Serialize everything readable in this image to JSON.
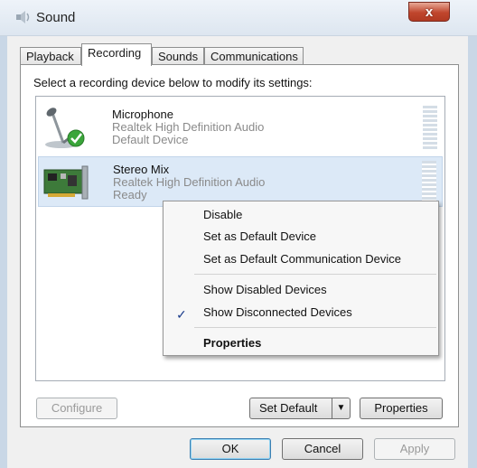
{
  "window": {
    "title": "Sound",
    "close_label": "x"
  },
  "tabs": [
    {
      "label": "Playback"
    },
    {
      "label": "Recording"
    },
    {
      "label": "Sounds"
    },
    {
      "label": "Communications"
    }
  ],
  "recording": {
    "instruction": "Select a recording device below to modify its settings:",
    "devices": [
      {
        "name": "Microphone",
        "description": "Realtek High Definition Audio",
        "status": "Default Device",
        "icon": "microphone-icon",
        "default_check": true
      },
      {
        "name": "Stereo Mix",
        "description": "Realtek High Definition Audio",
        "status": "Ready",
        "icon": "sound-card-icon",
        "selected": true
      }
    ]
  },
  "context_menu": {
    "items": [
      {
        "label": "Disable"
      },
      {
        "label": "Set as Default Device"
      },
      {
        "label": "Set as Default Communication Device"
      },
      {
        "label": "Show Disabled Devices"
      },
      {
        "label": "Show Disconnected Devices",
        "checked": true
      },
      {
        "label": "Properties",
        "bold": true
      }
    ]
  },
  "buttons": {
    "configure": "Configure",
    "set_default": "Set Default",
    "properties": "Properties",
    "ok": "OK",
    "cancel": "Cancel",
    "apply": "Apply"
  },
  "colors": {
    "selection": "#dce9f7",
    "close_button": "#c0462d",
    "check_green": "#3aa53a"
  }
}
